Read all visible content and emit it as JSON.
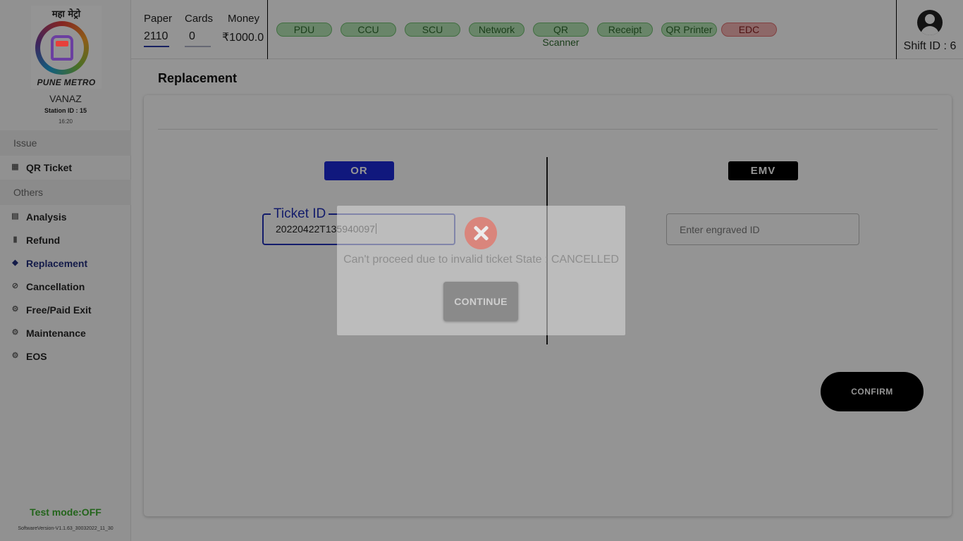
{
  "sidebar": {
    "logo_hindi": "महा मेट्रो",
    "logo_text": "PUNE METRO",
    "station_name": "VANAZ",
    "station_id": "Station ID : 15",
    "time": "16:20",
    "section_issue": "Issue",
    "section_others": "Others",
    "items": [
      {
        "label": "QR Ticket",
        "icon": "qr-icon"
      },
      {
        "label": "Analysis",
        "icon": "chart-icon"
      },
      {
        "label": "Refund",
        "icon": "receipt-icon"
      },
      {
        "label": "Replacement",
        "icon": "swap-icon"
      },
      {
        "label": "Cancellation",
        "icon": "cancel-icon"
      },
      {
        "label": "Free/Paid Exit",
        "icon": "gear-icon"
      },
      {
        "label": "Maintenance",
        "icon": "gear-icon"
      },
      {
        "label": "EOS",
        "icon": "gear-icon"
      }
    ],
    "test_mode": "Test mode:OFF",
    "software_version": "SoftwareVersion-V1.1.63_30032022_11_30"
  },
  "topbar": {
    "paper_label": "Paper",
    "paper_value": "2110",
    "cards_label": "Cards",
    "cards_value": "0",
    "money_label": "Money",
    "money_value": "₹1000.0",
    "status_pills": [
      {
        "label": "PDU",
        "status": "ok"
      },
      {
        "label": "CCU",
        "status": "ok"
      },
      {
        "label": "SCU",
        "status": "ok"
      },
      {
        "label": "Network",
        "status": "ok"
      },
      {
        "label": "QR Scanner",
        "status": "ok"
      },
      {
        "label": "Receipt",
        "status": "ok"
      },
      {
        "label": "QR Printer",
        "status": "ok"
      },
      {
        "label": "EDC",
        "status": "error"
      }
    ],
    "shift_id": "Shift ID : 6"
  },
  "main": {
    "title": "Replacement",
    "or_label": "OR",
    "emv_label": "EMV",
    "ticket_id_label": "Ticket ID",
    "ticket_id_value": "20220422T135940097",
    "engraved_placeholder": "Enter engraved ID",
    "confirm_label": "CONFIRM"
  },
  "dialog": {
    "message": "Can't proceed due to invalid ticket State : CANCELLED",
    "continue_label": "CONTINUE"
  },
  "colors": {
    "accent_blue": "#1c2ad8",
    "ok_green": "#b6e6b6",
    "error_red": "#f3b4b4",
    "test_mode_green": "#3dac2f"
  }
}
